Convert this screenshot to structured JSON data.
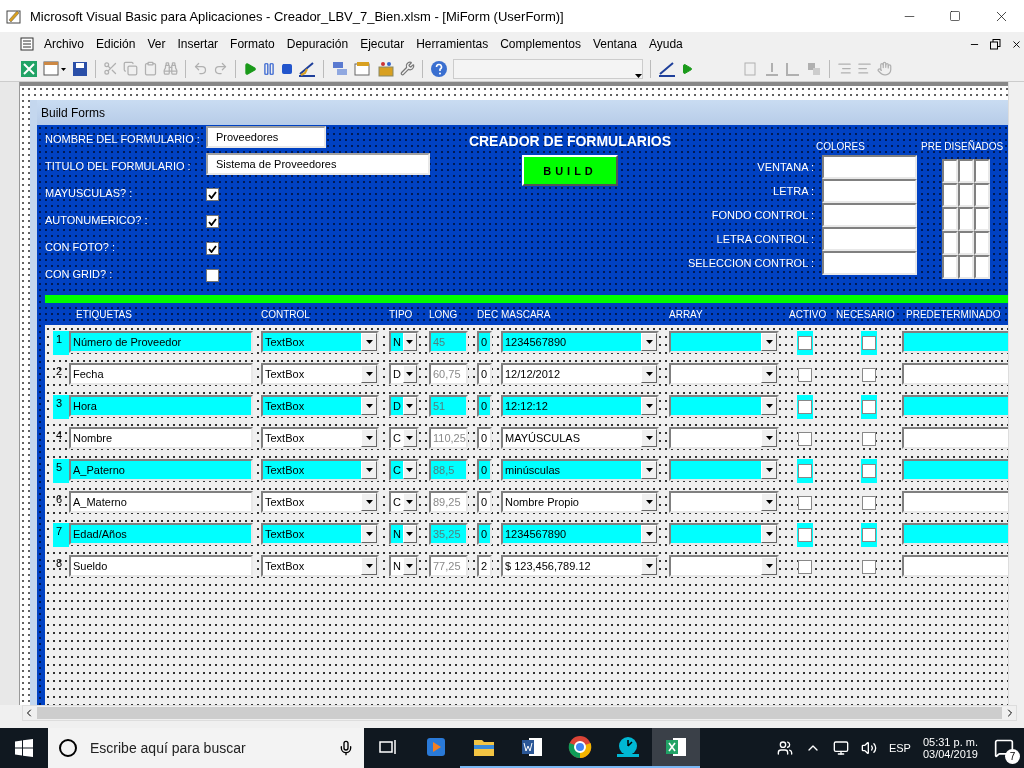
{
  "window": {
    "title": "Microsoft Visual Basic para Aplicaciones - Creador_LBV_7_Bien.xlsm - [MiForm (UserForm)]"
  },
  "menu": [
    "Archivo",
    "Edición",
    "Ver",
    "Insertar",
    "Formato",
    "Depuración",
    "Ejecutar",
    "Herramientas",
    "Complementos",
    "Ventana",
    "Ayuda"
  ],
  "form": {
    "caption": "Build Forms",
    "fields": [
      {
        "kind": "text",
        "label": "NOMBRE DEL FORMULARIO :",
        "value": "Proveedores"
      },
      {
        "kind": "text",
        "label": "TITULO DEL FORMULARIO :",
        "value": "Sistema de Proveedores"
      },
      {
        "kind": "check",
        "label": "MAYUSCULAS? :",
        "checked": true
      },
      {
        "kind": "check",
        "label": "AUTONUMERICO? :",
        "checked": true
      },
      {
        "kind": "check",
        "label": "CON FOTO? :",
        "checked": true
      },
      {
        "kind": "check",
        "label": "CON GRID? :",
        "checked": false
      }
    ],
    "heading": "CREADOR DE FORMULARIOS",
    "build_button": "BUILD",
    "colors": {
      "title": "COLORES",
      "items": [
        "VENTANA :",
        "LETRA :",
        "FONDO CONTROL :",
        "LETRA CONTROL :",
        "SELECCION CONTROL :"
      ]
    },
    "presets": {
      "title": "PRE DISEÑADOS"
    },
    "columns": [
      "ETIQUETAS",
      "CONTROL",
      "TIPO",
      "LONG",
      "DEC",
      "MASCARA",
      "ARRAY",
      "ACTIVO",
      "NECESARIO",
      "PREDETERMINADO"
    ],
    "rows": [
      {
        "number": "1",
        "highlighted": true,
        "label": "Número de Proveedor",
        "control": "TextBox",
        "type": "N",
        "length": "45",
        "decimals": "0",
        "mask": "1234567890",
        "active": false,
        "required": false
      },
      {
        "number": "2",
        "highlighted": false,
        "label": "Fecha",
        "control": "TextBox",
        "type": "D",
        "length": "60,75",
        "decimals": "0",
        "mask": "12/12/2012",
        "active": false,
        "required": false
      },
      {
        "number": "3",
        "highlighted": true,
        "label": "Hora",
        "control": "TextBox",
        "type": "D",
        "length": "51",
        "decimals": "0",
        "mask": "12:12:12",
        "active": false,
        "required": false
      },
      {
        "number": "4",
        "highlighted": false,
        "label": "Nombre",
        "control": "TextBox",
        "type": "C",
        "length": "110,25",
        "decimals": "0",
        "mask": "MAYÚSCULAS",
        "active": false,
        "required": false
      },
      {
        "number": "5",
        "highlighted": true,
        "label": "A_Paterno",
        "control": "TextBox",
        "type": "C",
        "length": "88,5",
        "decimals": "0",
        "mask": "minúsculas",
        "active": false,
        "required": false
      },
      {
        "number": "6",
        "highlighted": false,
        "label": "A_Materno",
        "control": "TextBox",
        "type": "C",
        "length": "89,25",
        "decimals": "0",
        "mask": "Nombre Propio",
        "active": false,
        "required": false
      },
      {
        "number": "7",
        "highlighted": true,
        "label": "Edad/Años",
        "control": "TextBox",
        "type": "N",
        "length": "35,25",
        "decimals": "0",
        "mask": "1234567890",
        "active": false,
        "required": false
      },
      {
        "number": "8",
        "highlighted": false,
        "label": "Sueldo",
        "control": "TextBox",
        "type": "N",
        "length": "77,25",
        "decimals": "2",
        "mask": "$  123,456,789.12",
        "active": false,
        "required": false
      }
    ]
  },
  "taskbar": {
    "search": {
      "placeholder": "Escribe aquí para buscar"
    },
    "apps": [
      {
        "kind": "media",
        "running": false,
        "selected": false
      },
      {
        "kind": "folder",
        "running": true,
        "selected": false
      },
      {
        "kind": "word",
        "running": true,
        "selected": false
      },
      {
        "kind": "browser",
        "running": true,
        "selected": false
      },
      {
        "kind": "clock",
        "running": true,
        "selected": false
      },
      {
        "kind": "excel",
        "running": true,
        "selected": true
      }
    ],
    "language": "ESP",
    "time": "05:31 p. m.",
    "date": "03/04/2019",
    "notifications": "7"
  }
}
